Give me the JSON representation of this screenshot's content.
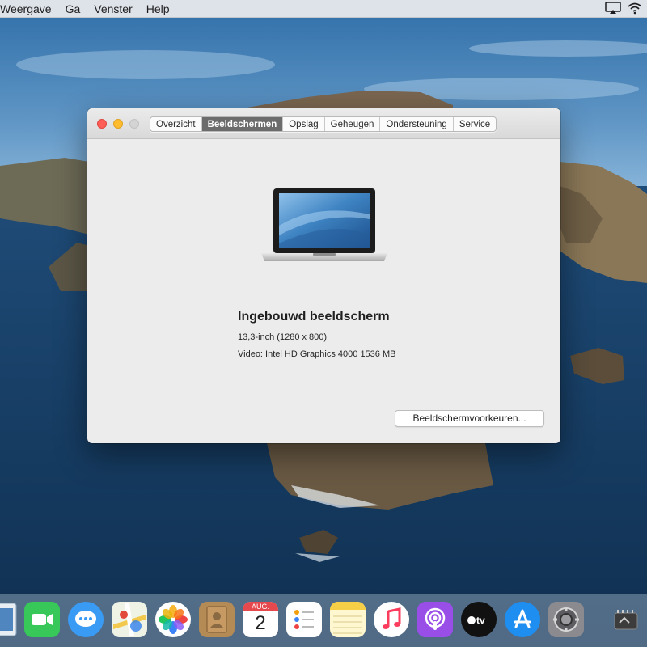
{
  "menubar": {
    "items": [
      "Weergave",
      "Ga",
      "Venster",
      "Help"
    ],
    "icons": [
      "airplay-icon",
      "wifi-icon"
    ]
  },
  "window": {
    "tabs": [
      {
        "label": "Overzicht",
        "active": false
      },
      {
        "label": "Beeldschermen",
        "active": true
      },
      {
        "label": "Opslag",
        "active": false
      },
      {
        "label": "Geheugen",
        "active": false
      },
      {
        "label": "Ondersteuning",
        "active": false
      },
      {
        "label": "Service",
        "active": false
      }
    ],
    "display": {
      "title": "Ingebouwd beeldscherm",
      "size": "13,3-inch (1280 x 800)",
      "video": "Video: Intel HD Graphics 4000 1536 MB"
    },
    "button_label": "Beeldschermvoorkeuren..."
  },
  "dock": {
    "calendar_month": "AUG.",
    "calendar_day": "2",
    "items": [
      "preview-icon",
      "facetime-icon",
      "messages-icon",
      "maps-icon",
      "photos-icon",
      "contacts-icon",
      "calendar-icon",
      "reminders-icon",
      "notes-icon",
      "music-icon",
      "podcasts-icon",
      "apple-tv-icon",
      "app-store-icon",
      "system-preferences-icon",
      "system-information-icon"
    ]
  },
  "colors": {
    "close": "#ff5f57",
    "minimize": "#febc2e",
    "active_tab": "#6c6c6c"
  }
}
